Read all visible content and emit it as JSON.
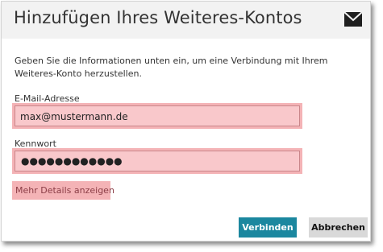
{
  "dialog": {
    "title": "Hinzufügen Ihres Weiteres-Kontos",
    "description": "Geben Sie die Informationen unten ein, um eine Verbindung mit Ihrem Weiteres-Konto herzustellen.",
    "header_icon": "mail-icon"
  },
  "form": {
    "email_label": "E-Mail-Adresse",
    "email_value": "max@mustermann.de",
    "password_label": "Kennwort",
    "password_value": "●●●●●●●●●●●●",
    "details_link": "Mehr Details anzeigen"
  },
  "buttons": {
    "connect_label": "Verbinden",
    "cancel_label": "Abbrechen"
  },
  "colors": {
    "title_bar": "#f2f2f2",
    "highlight": "#f4b3b6",
    "primary_button": "#1b879f",
    "secondary_button": "#d9d9d9"
  }
}
